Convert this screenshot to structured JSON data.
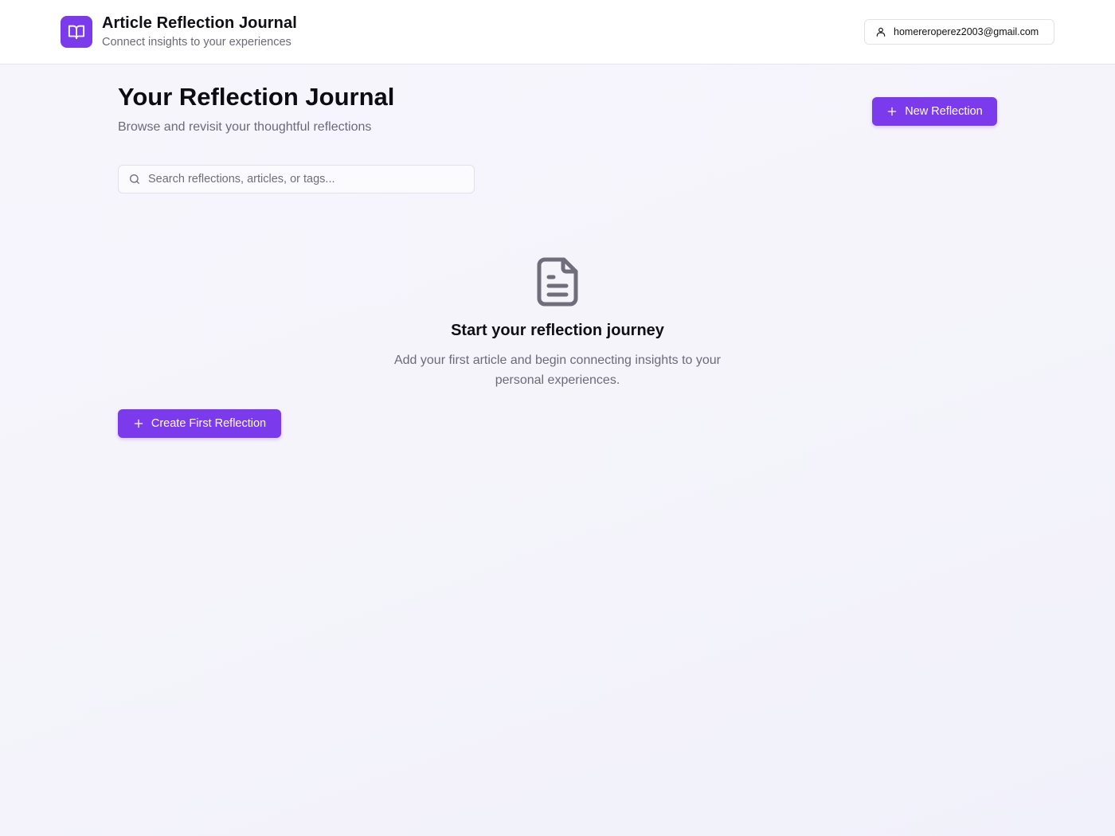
{
  "header": {
    "title": "Article Reflection Journal",
    "subtitle": "Connect insights to your experiences",
    "user_email": "homereroperez2003@gmail.com",
    "logo_icon": "book-open-icon",
    "user_icon": "user-icon"
  },
  "main": {
    "title": "Your Reflection Journal",
    "subtitle": "Browse and revisit your thoughtful reflections",
    "new_button_label": "New Reflection",
    "new_button_icon": "plus-icon"
  },
  "search": {
    "placeholder": "Search reflections, articles, or tags...",
    "value": "",
    "icon": "search-icon"
  },
  "empty_state": {
    "icon": "file-text-icon",
    "title": "Start your reflection journey",
    "description": "Add your first article and begin connecting insights to your personal experiences.",
    "button_label": "Create First Reflection",
    "button_icon": "plus-icon"
  },
  "colors": {
    "accent": "#7c3aed",
    "background": "#f5f4fb",
    "muted_text": "#6b6b78"
  }
}
